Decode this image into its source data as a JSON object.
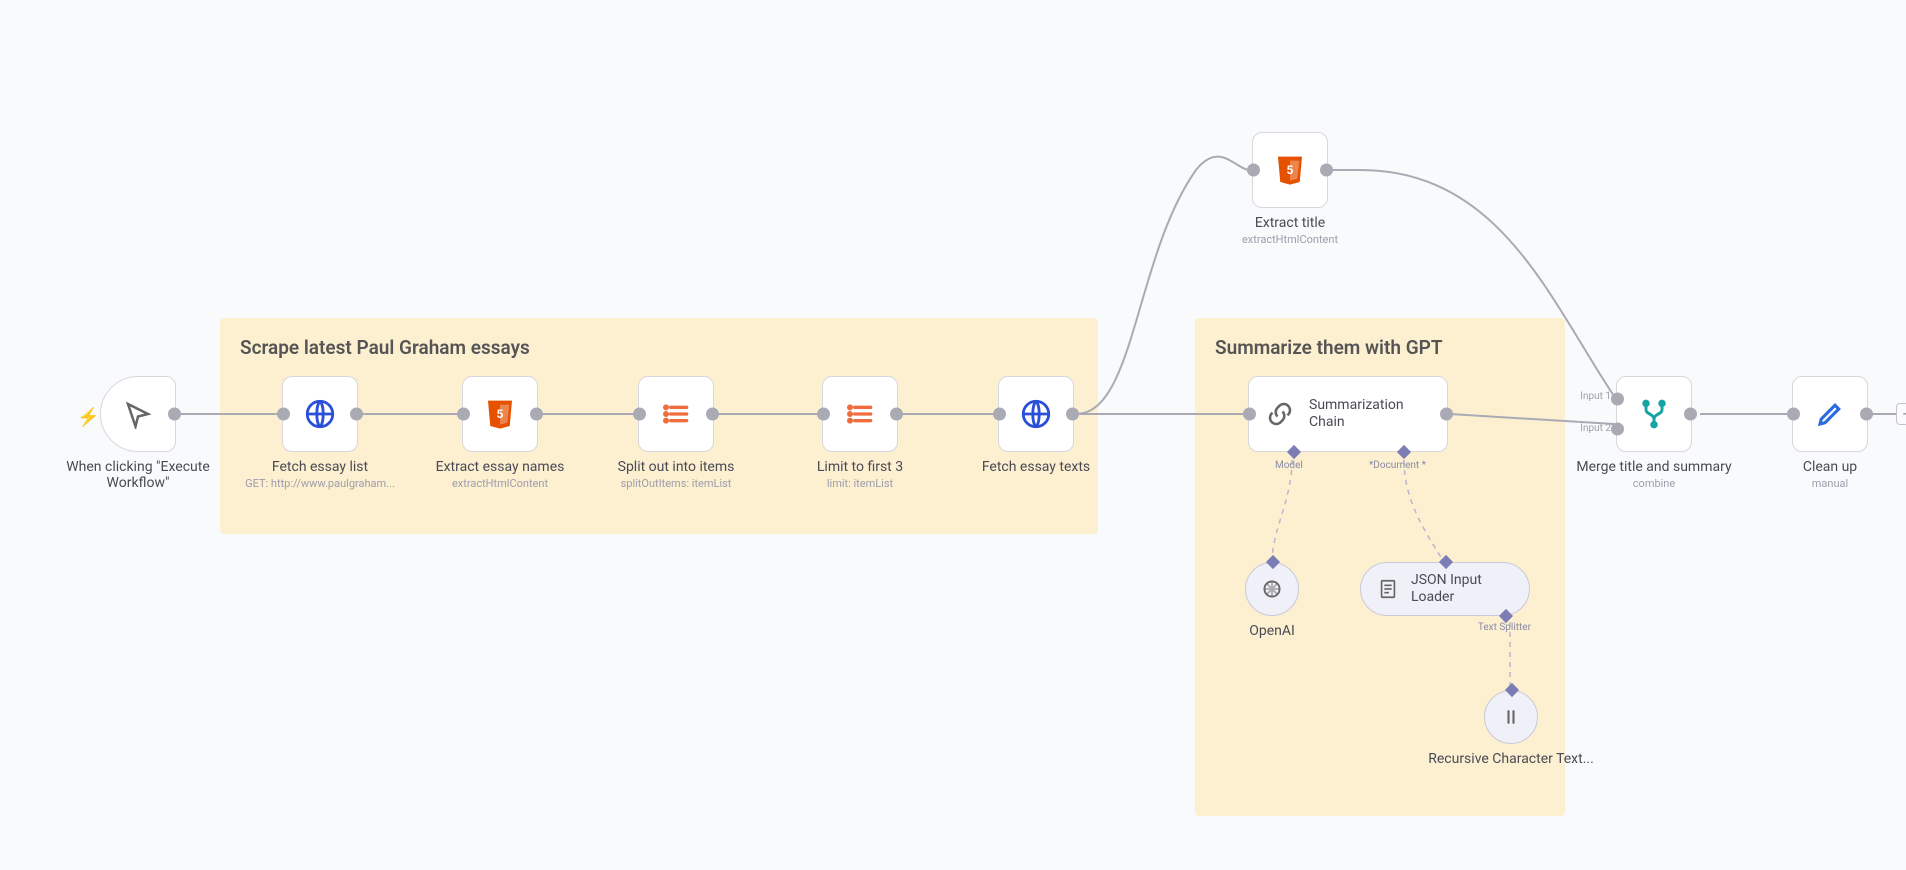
{
  "groups": {
    "scrape": {
      "title": "Scrape latest Paul Graham essays"
    },
    "summarize": {
      "title": "Summarize them with GPT"
    }
  },
  "nodes": {
    "trigger": {
      "label": "When clicking \"Execute Workflow\""
    },
    "fetch_list": {
      "label": "Fetch essay list",
      "sub": "GET: http://www.paulgraham..."
    },
    "extract_names": {
      "label": "Extract essay names",
      "sub": "extractHtmlContent"
    },
    "split": {
      "label": "Split out into items",
      "sub": "splitOutItems: itemList"
    },
    "limit": {
      "label": "Limit to first 3",
      "sub": "limit: itemList"
    },
    "fetch_texts": {
      "label": "Fetch essay texts"
    },
    "extract_title": {
      "label": "Extract title",
      "sub": "extractHtmlContent"
    },
    "sum_chain": {
      "label": "Summarization Chain"
    },
    "openai": {
      "label": "OpenAI"
    },
    "json_loader": {
      "label": "JSON Input Loader"
    },
    "rct": {
      "label": "Recursive Character Text..."
    },
    "merge": {
      "label": "Merge title and summary",
      "sub": "combine",
      "input1": "Input 1",
      "input2": "Input 2"
    },
    "cleanup": {
      "label": "Clean up",
      "sub": "manual"
    }
  },
  "ai_ports": {
    "model": "Model",
    "document": "*Document *",
    "text_splitter": "Text Splitter"
  }
}
